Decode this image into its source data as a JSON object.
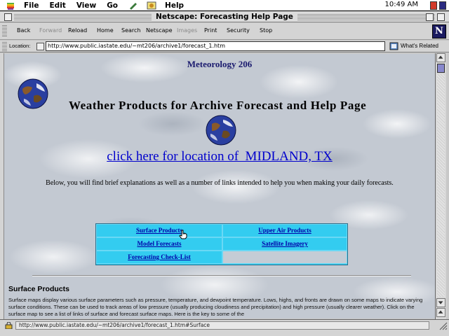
{
  "menubar": {
    "items": [
      "File",
      "Edit",
      "View",
      "Go",
      "Help"
    ],
    "clock": "10:49 AM"
  },
  "window": {
    "title": "Netscape: Forecasting Help Page"
  },
  "toolbar": {
    "buttons": [
      {
        "label": "Back",
        "enabled": true
      },
      {
        "label": "Forward",
        "enabled": false
      },
      {
        "label": "Reload",
        "enabled": true
      },
      {
        "label": "Home",
        "enabled": true
      },
      {
        "label": "Search",
        "enabled": true
      },
      {
        "label": "Netscape",
        "enabled": true
      },
      {
        "label": "Images",
        "enabled": false
      },
      {
        "label": "Print",
        "enabled": true
      },
      {
        "label": "Security",
        "enabled": true
      },
      {
        "label": "Stop",
        "enabled": true
      }
    ],
    "logo_letter": "N"
  },
  "location": {
    "label": "Location:",
    "url": "http://www.public.iastate.edu/~mt206/archive1/forecast_1.htm",
    "related_label": "What's Related"
  },
  "page": {
    "course_title": "Meteorology 206",
    "heading": "Weather Products for Archive Forecast and Help Page",
    "location_link": "click here for location of  MIDLAND, TX",
    "intro": "Below, you will find brief explanations as well as a number of links intended to help you when making your daily forecasts.",
    "link_table": [
      "Surface Products",
      "Upper Air Products",
      "Model Forecasts",
      "Satellite Imagery",
      "Forecasting Check-List"
    ],
    "section_heading": "Surface Products",
    "section_body": "Surface maps display various surface parameters such as pressure, temperature, and dewpoint temperature. Lows, highs, and fronts are drawn on some maps to indicate varying surface conditions. These can be used to track areas of low pressure (usually producing cloudiness and precipitation) and high pressure (usually clearer weather).  Click on the surface map to see a list of links of surface and forecast surface maps. Here is the key to some of the"
  },
  "status": {
    "text": "http://www.public.iastate.edu/~mt206/archive1/forecast_1.htm#Surface"
  },
  "colors": {
    "link": "#0000cc",
    "table_bg": "#33ccf0",
    "course_title": "#1a1a6e",
    "scroll_thumb": "#8888cc"
  },
  "icons": [
    "apple-icon",
    "netscape-n-icon",
    "globe-icon",
    "security-lock-icon",
    "page-proxy-icon",
    "whats-related-icon"
  ]
}
